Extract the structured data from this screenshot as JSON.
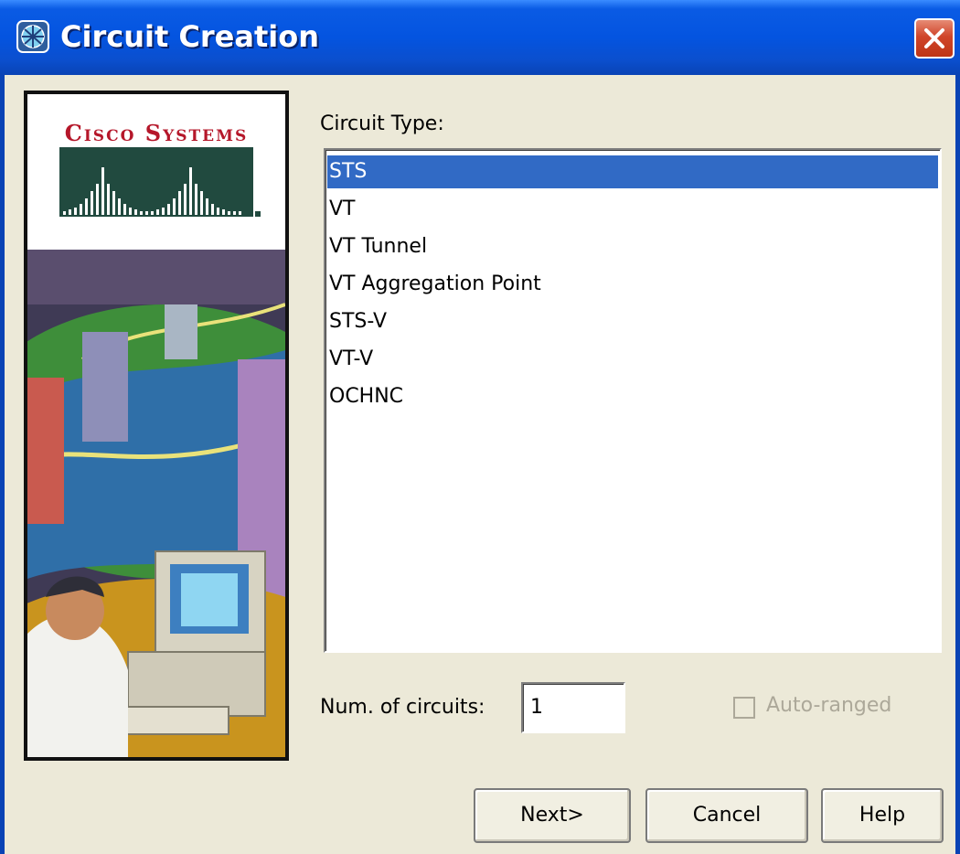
{
  "window": {
    "title": "Circuit Creation",
    "icon": "app-icon",
    "close_icon": "close-icon"
  },
  "branding": {
    "logo_text": "Cisco Systems"
  },
  "circuit_type": {
    "label": "Circuit Type:",
    "items": [
      {
        "label": "STS",
        "selected": true
      },
      {
        "label": "VT",
        "selected": false
      },
      {
        "label": "VT Tunnel",
        "selected": false
      },
      {
        "label": "VT Aggregation Point",
        "selected": false
      },
      {
        "label": "STS-V",
        "selected": false
      },
      {
        "label": "VT-V",
        "selected": false
      },
      {
        "label": "OCHNC",
        "selected": false
      }
    ]
  },
  "num_circuits": {
    "label": "Num. of circuits:",
    "value": "1"
  },
  "auto_ranged": {
    "label": "Auto-ranged",
    "checked": false,
    "enabled": false
  },
  "buttons": {
    "next": "Next>",
    "cancel": "Cancel",
    "help": "Help"
  },
  "colors": {
    "selection": "#316AC5",
    "titlebar": "#0454E0",
    "dialog_bg": "#ECE9D8",
    "logo_red": "#B5172A",
    "logo_bars": "#214A3F"
  }
}
